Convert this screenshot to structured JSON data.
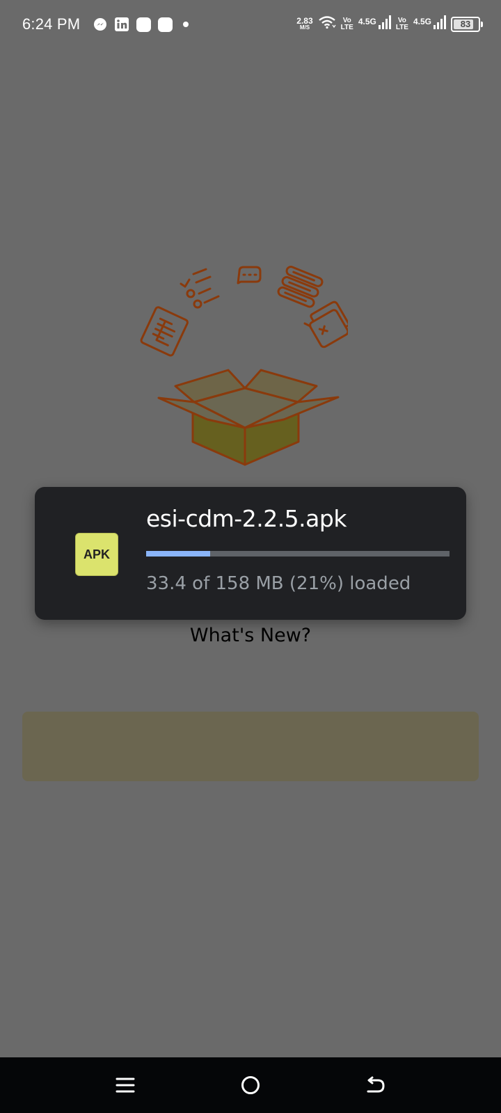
{
  "status_bar": {
    "time": "6:24 PM",
    "net_speed_value": "2.83",
    "net_speed_unit": "M/S",
    "sim1_volte_top": "Vo",
    "sim1_volte_bottom": "LTE",
    "sim1_network": "4.5G",
    "sim2_volte_top": "Vo",
    "sim2_volte_bottom": "LTE",
    "sim2_network": "4.5G",
    "battery_level": "83",
    "notification_icons": [
      "messenger-icon",
      "linkedin-icon",
      "app-icon",
      "app-icon",
      "dot-icon"
    ]
  },
  "download": {
    "file_icon_label": "APK",
    "file_name": "esi-cdm-2.2.5.apk",
    "progress_text": "33.4 of 158 MB (21%) loaded",
    "progress_fraction": 0.21
  },
  "main": {
    "whats_new": "What's New?"
  },
  "colors": {
    "illustration_stroke": "#8a3a0c",
    "box_fill": "#66601f",
    "progress": "#8ab4f8",
    "card_bg": "#202124"
  },
  "nav_bar": {
    "icons": [
      "menu-icon",
      "home-icon",
      "back-icon"
    ]
  }
}
